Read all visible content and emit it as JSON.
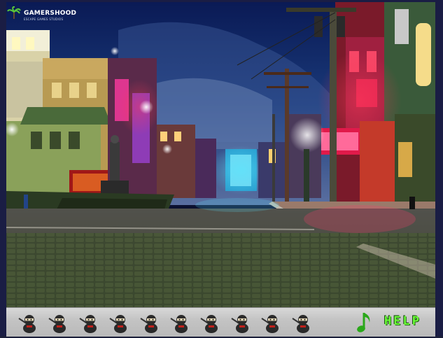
{
  "logo": {
    "brand": "GAMERSHOOD",
    "tagline": "ESCAPE GAMES STUDIOS"
  },
  "scene": {
    "description_icon": "night-street-scene"
  },
  "inventory": {
    "slot_count": 10,
    "item_icon": "ninja-icon"
  },
  "toolbar": {
    "help_label": "HELP",
    "music_icon": "music-note-icon"
  },
  "colors": {
    "help": "#6dff3a",
    "frame": "#1a1d44",
    "toolbar": "#c4c4c4"
  }
}
